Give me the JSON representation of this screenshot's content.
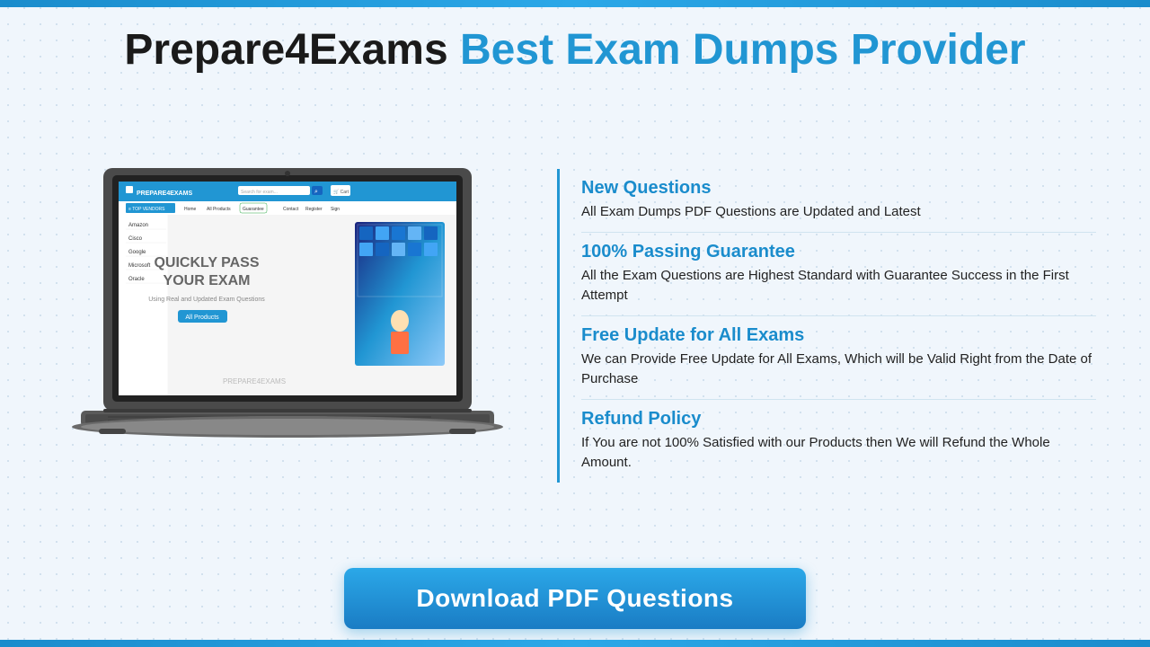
{
  "header": {
    "brand": "Prepare4Exams",
    "tagline": "Best Exam Dumps Provider"
  },
  "features": [
    {
      "id": "new-questions",
      "title": "New Questions",
      "description": "All Exam Dumps PDF Questions are Updated and Latest"
    },
    {
      "id": "passing-guarantee",
      "title": "100% Passing Guarantee",
      "description": "All the Exam Questions are Highest Standard with Guarantee Success in the First Attempt"
    },
    {
      "id": "free-update",
      "title": "Free Update for All Exams",
      "description": "We can Provide Free Update for All Exams, Which will be Valid Right from the Date of Purchase"
    },
    {
      "id": "refund-policy",
      "title": "Refund Policy",
      "description": "If You are not 100% Satisfied with our Products then We will Refund the Whole Amount."
    }
  ],
  "download_button": {
    "label": "Download PDF Questions"
  },
  "mini_site": {
    "brand": "PREPARE4EXAMS",
    "search_placeholder": "Search for exam...",
    "hero_text": "QUICKLY PASS\nYOUR EXAM",
    "sub_text": "Using Real and Updated Exam Questions",
    "all_products": "All Products",
    "nav_items": [
      "Home",
      "All Products",
      "Guarantee",
      "Contact",
      "Register",
      "Sign"
    ],
    "sidebar_items": [
      "Amazon",
      "Cisco",
      "Google",
      "Microsoft",
      "Oracle"
    ],
    "watermark": "PREPARE4EXAMS",
    "top_vendors": "≡  TOP VENDORS",
    "cart_text": "Cart"
  },
  "colors": {
    "blue_accent": "#2196d3",
    "dark_blue": "#1a7cc4",
    "title_black": "#1a1a1a",
    "background": "#f0f6fc"
  }
}
